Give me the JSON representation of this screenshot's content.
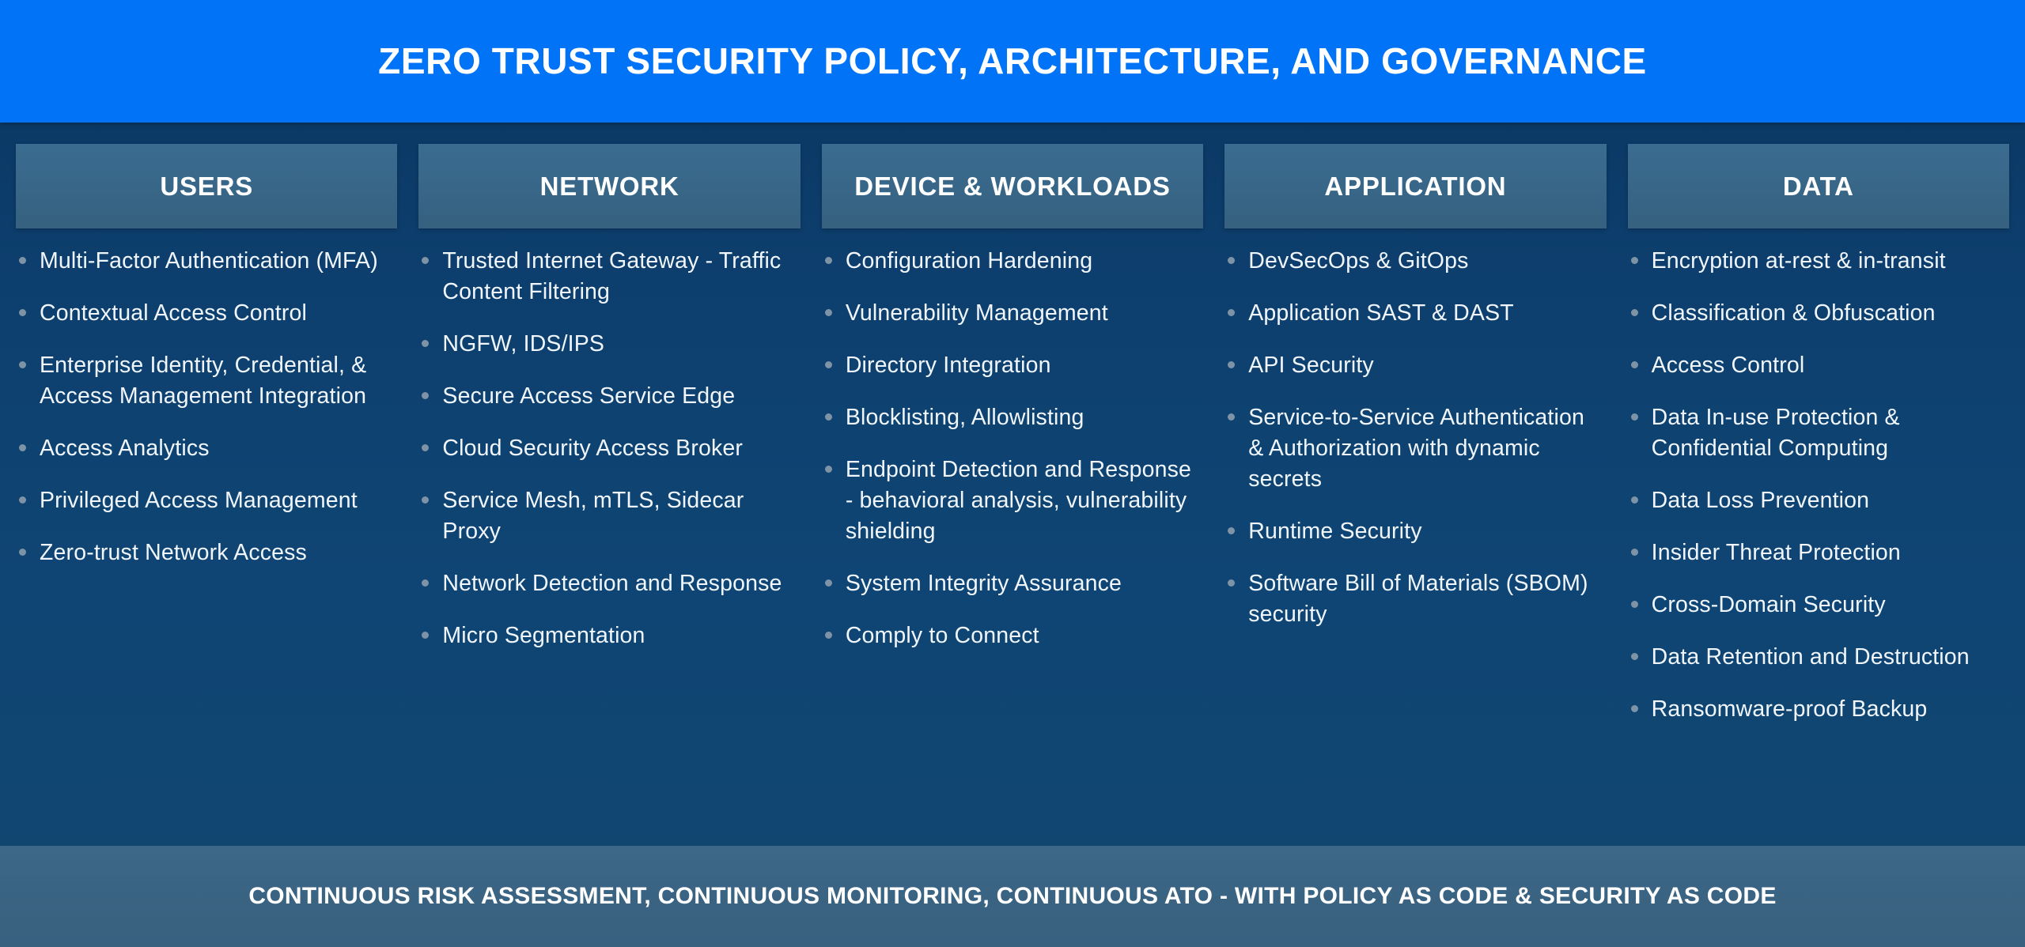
{
  "header": {
    "title": "ZERO TRUST SECURITY POLICY, ARCHITECTURE, AND GOVERNANCE",
    "background_color": "#0073f7",
    "text_color": "#ffffff"
  },
  "footer": {
    "text": "CONTINUOUS RISK ASSESSMENT, CONTINUOUS MONITORING, CONTINUOUS ATO - WITH POLICY AS CODE & SECURITY AS CODE",
    "background_color": "#3a6382",
    "text_color": "#ffffff"
  },
  "theme": {
    "body_background_top": "#0a3560",
    "body_background_bottom": "#11466f",
    "pillar_header_background": "#376384",
    "bullet_color": "#7f93a6",
    "list_text_color": "#f0f6fb"
  },
  "pillars": [
    {
      "title": "USERS",
      "items": [
        "Multi-Factor Authentication (MFA)",
        "Contextual Access Control",
        "Enterprise Identity, Credential, & Access Management Integration",
        "Access Analytics",
        "Privileged Access Management",
        "Zero-trust Network Access"
      ]
    },
    {
      "title": "NETWORK",
      "items": [
        "Trusted Internet Gateway - Traffic Content Filtering",
        "NGFW, IDS/IPS",
        "Secure Access Service Edge",
        "Cloud Security Access Broker",
        "Service Mesh, mTLS, Sidecar Proxy",
        "Network Detection and Response",
        "Micro Segmentation"
      ]
    },
    {
      "title": "DEVICE & WORKLOADS",
      "items": [
        "Configuration Hardening",
        "Vulnerability Management",
        "Directory Integration",
        "Blocklisting, Allowlisting",
        "Endpoint Detection and Response - behavioral analysis, vulnerability shielding",
        "System Integrity Assurance",
        "Comply to Connect"
      ]
    },
    {
      "title": "APPLICATION",
      "items": [
        "DevSecOps & GitOps",
        "Application SAST & DAST",
        "API Security",
        "Service-to-Service Authentication & Authorization with dynamic secrets",
        "Runtime Security",
        "Software Bill of Materials (SBOM) security"
      ]
    },
    {
      "title": "DATA",
      "items": [
        "Encryption at-rest & in-transit",
        "Classification & Obfuscation",
        "Access Control",
        "Data In-use Protection & Confidential Computing",
        "Data Loss Prevention",
        "Insider Threat Protection",
        "Cross-Domain Security",
        "Data Retention and Destruction",
        "Ransomware-proof Backup"
      ]
    }
  ]
}
